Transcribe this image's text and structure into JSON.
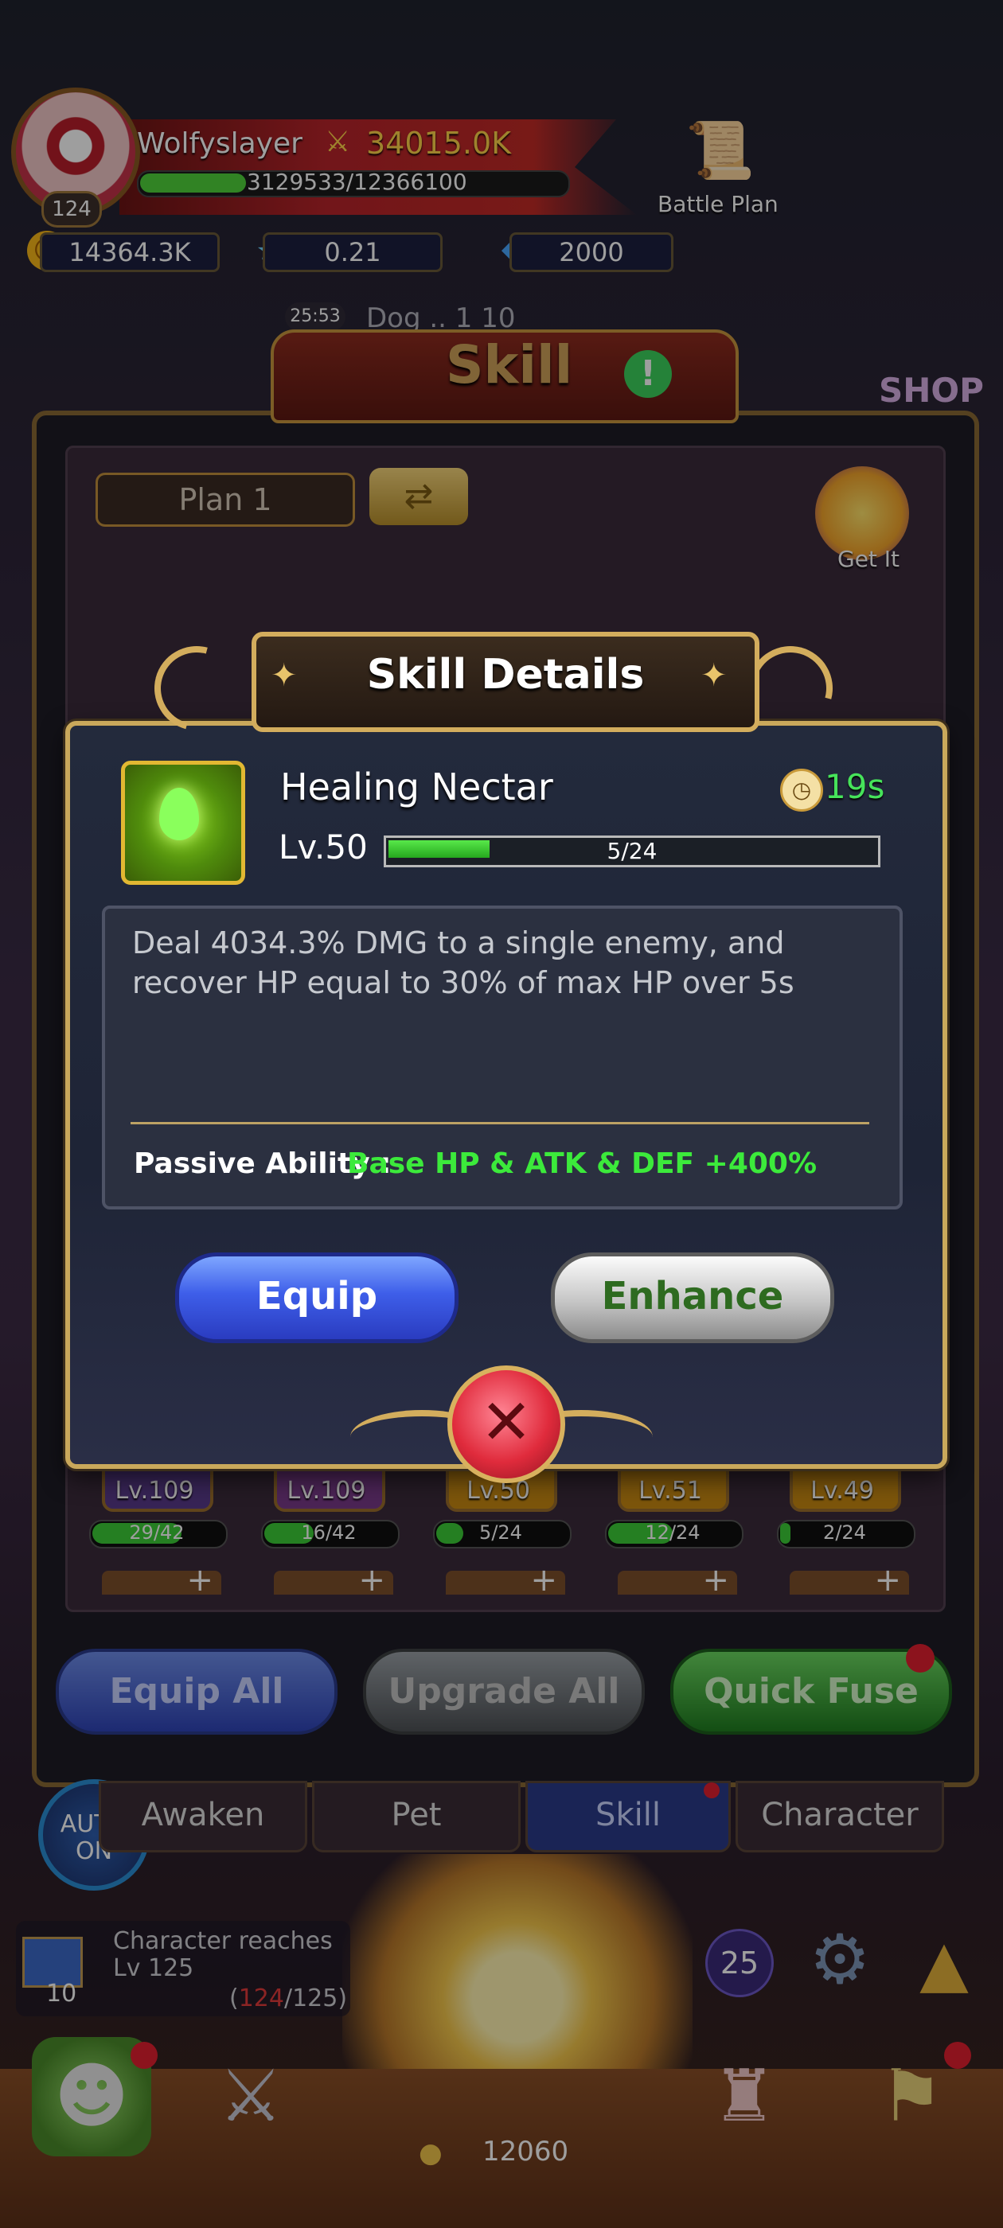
{
  "hud": {
    "player_name": "Wolfyslayer",
    "power": "34015.0K",
    "level": "124",
    "xp": "3129533/12366100",
    "xp_progress": 0.25,
    "gold": "14364.3K",
    "stars": "0.21",
    "gems": "2000",
    "battle_plan_label": "Battle Plan",
    "event_timer": "25:53",
    "dungeon_text": "Dog  ..  1  10"
  },
  "skill_screen": {
    "title": "Skill",
    "shop_label": "SHOP",
    "plan_label": "Plan 1",
    "get_it_label": "Get It",
    "slots": [
      {
        "level": "Lv.109",
        "progress": "29/42",
        "fraction": 0.69
      },
      {
        "level": "Lv.109",
        "progress": "16/42",
        "fraction": 0.38
      },
      {
        "level": "Lv.50",
        "progress": "5/24",
        "fraction": 0.21
      },
      {
        "level": "Lv.51",
        "progress": "12/24",
        "fraction": 0.5
      },
      {
        "level": "Lv.49",
        "progress": "2/24",
        "fraction": 0.08
      }
    ],
    "equip_all": "Equip All",
    "upgrade_all": "Upgrade All",
    "quick_fuse": "Quick Fuse"
  },
  "tabs": {
    "auto": "AUTO ON",
    "awaken": "Awaken",
    "pet": "Pet",
    "skill": "Skill",
    "character": "Character"
  },
  "quest": {
    "line1": "Character reaches",
    "line2": "Lv 125",
    "number": "10",
    "progress_current": "124",
    "progress_total": "/125)",
    "progress_open": "("
  },
  "bottom": {
    "ticket_count": "25",
    "coin_value": "12060"
  },
  "modal": {
    "title": "Skill Details",
    "skill_name": "Healing Nectar",
    "cooldown": "19s",
    "level": "Lv.50",
    "level_progress_text": "5/24",
    "level_progress": 0.21,
    "description": "Deal 4034.3% DMG to a single enemy, and recover HP equal to 30% of max HP over 5s",
    "passive_label": "Passive Ability :",
    "passive_value": "Base HP & ATK & DEF +400%",
    "equip_label": "Equip",
    "enhance_label": "Enhance",
    "close_symbol": "✕"
  },
  "colors": {
    "accent_gold": "#d3ad5d",
    "passive_green": "#3cea3b",
    "cooldown_green": "#46e35a",
    "equip_blue": "#3e5ee9"
  },
  "icons": [
    "sword-icon",
    "gold-coin-icon",
    "star-icon",
    "gem-icon",
    "battle-plan-icon",
    "info-icon",
    "swap-icon",
    "clock-icon",
    "close-icon",
    "gear-icon",
    "skill-leaf-icon"
  ]
}
